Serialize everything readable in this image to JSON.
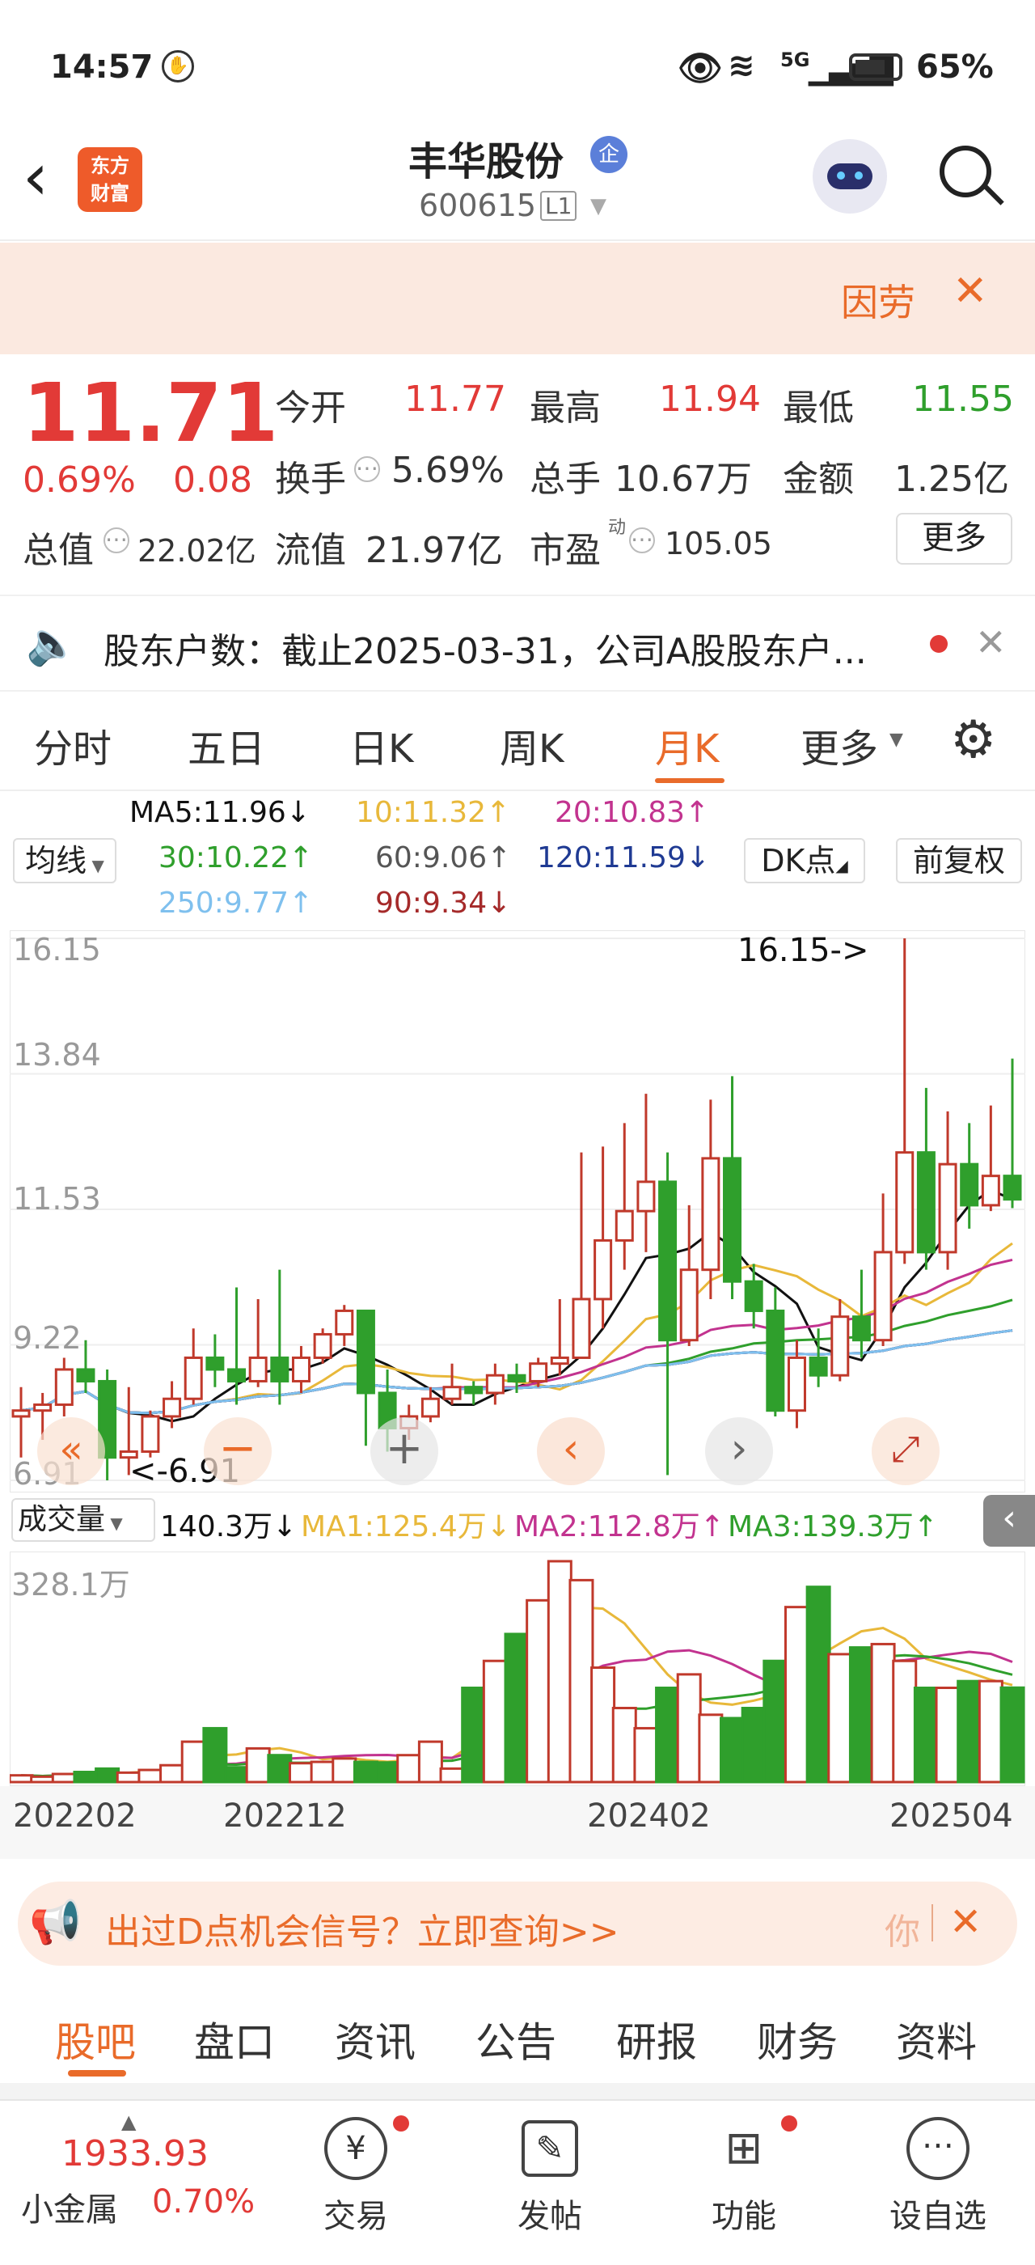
{
  "status": {
    "time": "14:57",
    "battery": "65%",
    "network": "5G"
  },
  "header": {
    "title": "丰华股份",
    "code": "600615",
    "level": "L1",
    "enterprise_badge": "企"
  },
  "banner": {
    "text": "因劳"
  },
  "quote": {
    "price": "11.71",
    "pct": "0.69%",
    "change": "0.08",
    "open_label": "今开",
    "open": "11.77",
    "high_label": "最高",
    "high": "11.94",
    "low_label": "最低",
    "low": "11.55",
    "turnover_label": "换手",
    "turnover": "5.69%",
    "volume_label": "总手",
    "volume": "10.67万",
    "amount_label": "金额",
    "amount": "1.25亿",
    "mktcap_label": "总值",
    "mktcap": "22.02亿",
    "float_label": "流值",
    "float": "21.97亿",
    "pe_label": "市盈",
    "pe_sup": "动",
    "pe": "105.05",
    "more": "更多"
  },
  "notice": {
    "text": "股东户数：截止2025-03-31，公司A股股东户..."
  },
  "tabs": [
    "分时",
    "五日",
    "日K",
    "周K",
    "月K",
    "更多"
  ],
  "ma": {
    "ma_button": "均线",
    "ma5": "MA5:11.96↓",
    "ma10": "10:11.32↑",
    "ma20": "20:10.83↑",
    "ma30": "30:10.22↑",
    "ma60": "60:9.06↑",
    "ma120": "120:11.59↓",
    "ma250": "250:9.77↑",
    "ma90": "90:9.34↓",
    "dk_button": "DK点",
    "fq_button": "前复权"
  },
  "price_axis": [
    "16.15",
    "13.84",
    "11.53",
    "9.22",
    "6.91"
  ],
  "annotations": {
    "high": "16.15->",
    "low": "<-6.91"
  },
  "vol": {
    "vol_button": "成交量",
    "vol": "140.3万↓",
    "ma1": "MA1:125.4万↓",
    "ma2": "MA2:112.8万↑",
    "ma3": "MA3:139.3万↑",
    "max": "328.1万"
  },
  "x_labels": [
    "202202",
    "202212",
    "202402",
    "202504"
  ],
  "colors": {
    "up": "#c0392b",
    "down": "#2f9f2c",
    "accent": "#e96b2a",
    "ma5": "#111111",
    "ma10": "#e8b83a",
    "ma20": "#c2338f",
    "ma30": "#2f9f2c",
    "ma60": "#555555",
    "ma120": "#1f3a93",
    "ma250": "#7fc0ee",
    "ma90": "#a52a2a"
  },
  "chart_data": {
    "type": "candlestick",
    "period": "monthly",
    "ylim": [
      6.91,
      16.15
    ],
    "candles": [
      [
        8.0,
        8.1,
        7.3,
        8.5
      ],
      [
        8.1,
        8.2,
        7.6,
        8.4
      ],
      [
        8.2,
        8.8,
        8.0,
        9.0
      ],
      [
        8.8,
        8.6,
        8.4,
        9.3
      ],
      [
        8.6,
        7.3,
        6.91,
        8.8
      ],
      [
        7.3,
        7.4,
        7.0,
        8.5
      ],
      [
        7.4,
        8.0,
        7.3,
        8.1
      ],
      [
        8.0,
        8.3,
        7.8,
        8.6
      ],
      [
        8.3,
        9.0,
        8.2,
        9.5
      ],
      [
        9.0,
        8.8,
        8.5,
        9.4
      ],
      [
        8.8,
        8.6,
        8.2,
        10.2
      ],
      [
        8.6,
        9.0,
        8.5,
        10.0
      ],
      [
        9.0,
        8.6,
        8.2,
        10.5
      ],
      [
        8.6,
        9.0,
        8.4,
        9.2
      ],
      [
        9.0,
        9.4,
        8.9,
        9.5
      ],
      [
        9.4,
        9.8,
        9.2,
        9.9
      ],
      [
        9.8,
        8.4,
        7.5,
        9.8
      ],
      [
        8.4,
        7.8,
        7.4,
        8.8
      ],
      [
        7.8,
        8.0,
        7.6,
        8.2
      ],
      [
        8.0,
        8.3,
        7.9,
        8.5
      ],
      [
        8.3,
        8.5,
        8.2,
        8.9
      ],
      [
        8.5,
        8.4,
        8.2,
        8.6
      ],
      [
        8.4,
        8.7,
        8.2,
        8.9
      ],
      [
        8.7,
        8.6,
        8.4,
        8.9
      ],
      [
        8.6,
        8.9,
        8.5,
        9.0
      ],
      [
        8.9,
        9.0,
        8.7,
        10.0
      ],
      [
        9.0,
        10.0,
        9.0,
        12.5
      ],
      [
        10.0,
        11.0,
        9.5,
        12.6
      ],
      [
        11.0,
        11.5,
        10.5,
        13.0
      ],
      [
        11.5,
        12.0,
        10.8,
        13.5
      ],
      [
        12.0,
        9.3,
        7.0,
        12.5
      ],
      [
        9.3,
        10.5,
        9.2,
        11.6
      ],
      [
        10.5,
        12.4,
        10.0,
        13.4
      ],
      [
        12.4,
        10.3,
        10.0,
        13.8
      ],
      [
        10.3,
        9.8,
        9.5,
        10.6
      ],
      [
        9.8,
        8.1,
        8.0,
        10.2
      ],
      [
        8.1,
        9.0,
        7.8,
        9.3
      ],
      [
        9.0,
        8.7,
        8.5,
        9.5
      ],
      [
        8.7,
        9.7,
        8.6,
        10.0
      ],
      [
        9.7,
        9.3,
        9.0,
        10.5
      ],
      [
        9.3,
        10.8,
        9.2,
        11.8
      ],
      [
        10.8,
        12.5,
        10.6,
        16.15
      ],
      [
        12.5,
        10.8,
        10.5,
        13.6
      ],
      [
        10.8,
        12.3,
        10.5,
        13.2
      ],
      [
        12.3,
        11.6,
        11.2,
        13.0
      ],
      [
        11.6,
        12.1,
        11.5,
        13.3
      ],
      [
        12.1,
        11.7,
        11.55,
        14.1
      ]
    ],
    "volumes": [
      10,
      8,
      12,
      15,
      20,
      14,
      18,
      25,
      60,
      80,
      22,
      50,
      40,
      28,
      30,
      35,
      30,
      28,
      40,
      60,
      20,
      140,
      180,
      220,
      270,
      328.1,
      300,
      170,
      110,
      80,
      140,
      160,
      100,
      95,
      110,
      180,
      260,
      290,
      190,
      200,
      205,
      180,
      140,
      140,
      150,
      150,
      140.3
    ]
  }
}
